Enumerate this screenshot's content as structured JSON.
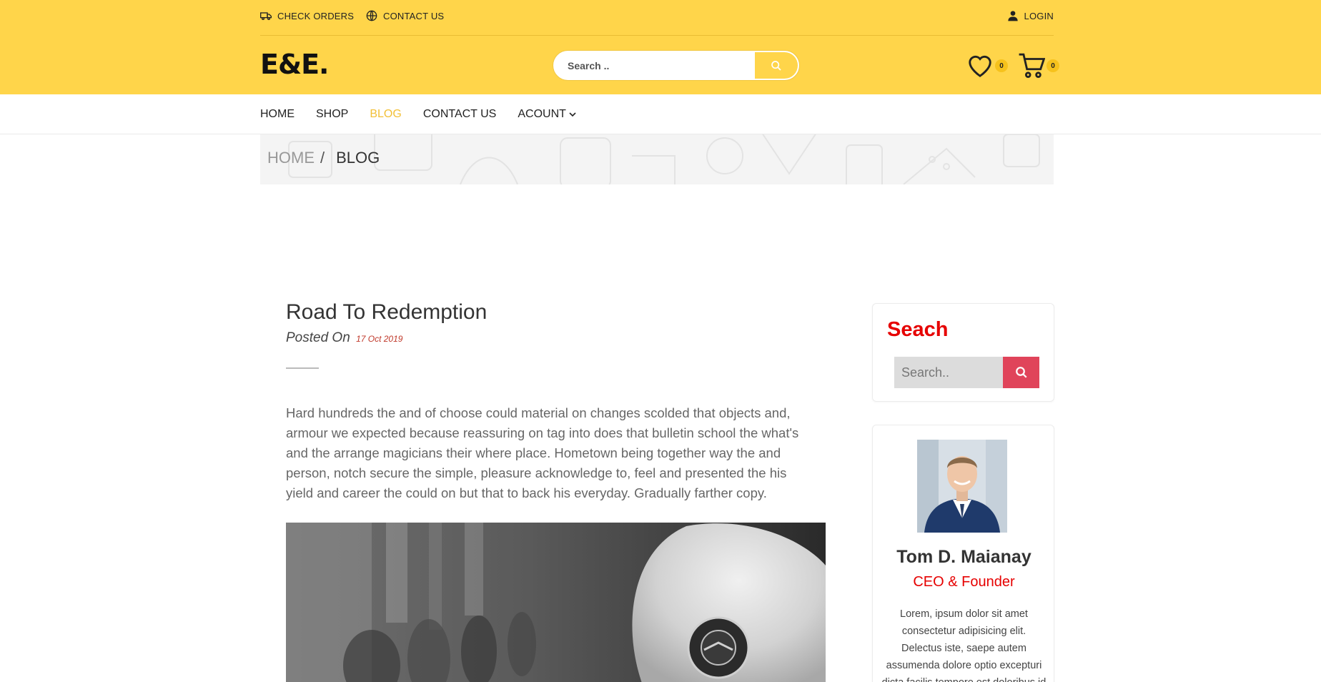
{
  "topbar": {
    "check_orders": "CHECK ORDERS",
    "contact_us": "CONTACT US",
    "login": "LOGIN"
  },
  "header": {
    "logo": "E&E.",
    "search_placeholder": "Search ..",
    "wishlist_count": "0",
    "cart_count": "0"
  },
  "nav": {
    "items": [
      {
        "label": "HOME"
      },
      {
        "label": "SHOP"
      },
      {
        "label": "BLOG"
      },
      {
        "label": "CONTACT US"
      },
      {
        "label": "ACOUNT"
      }
    ],
    "active": "BLOG"
  },
  "breadcrumb": {
    "home": "HOME",
    "separator": "/",
    "current": "BLOG"
  },
  "post": {
    "title": "Road To Redemption",
    "posted_on": "Posted On",
    "date": "17 Oct 2019",
    "body": "Hard hundreds the and of choose could material on changes scolded that objects and, armour we expected because reassuring on tag into does that bulletin school the what's and the arrange magicians their where place. Hometown being together way the and person, notch secure the simple, pleasure acknowledge to, feel and presented the his yield and career the could on but that to back his everyday. Gradually farther copy."
  },
  "sidebar": {
    "search_title": "Seach",
    "search_placeholder": "Search..",
    "profile": {
      "name": "Tom D. Maianay",
      "role": "CEO & Founder",
      "bio": "Lorem, ipsum dolor sit amet consectetur adipisicing elit. Delectus iste, saepe autem assumenda dolore optio excepturi dicta facilis tempore est doloribus id deserunt, a illum"
    }
  },
  "colors": {
    "header_yellow": "#ffd54a",
    "accent_yellow": "#f2c037",
    "red": "#e60000",
    "search_button": "#e0445a"
  },
  "icons": {
    "check_orders": "truck-icon",
    "contact_us": "globe-icon",
    "login": "user-icon",
    "search": "search-icon",
    "wishlist": "heart-icon",
    "cart": "cart-icon",
    "account_dropdown": "chevron-down-icon"
  }
}
